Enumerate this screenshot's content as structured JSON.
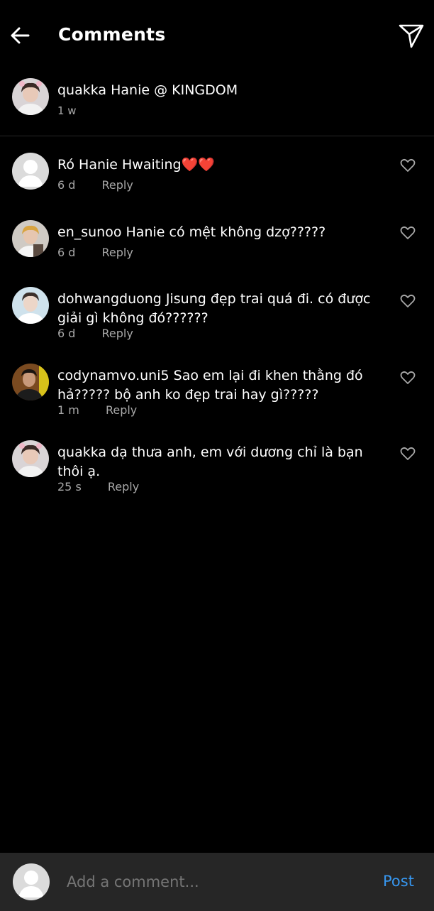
{
  "header": {
    "title": "Comments"
  },
  "caption": {
    "username": "quakka",
    "text": "Hanie @ KINGDOM",
    "time": "1 w"
  },
  "comments": [
    {
      "username": "Ró",
      "text": "Hanie Hwaiting",
      "emoji": "❤️❤️",
      "time": "6 d",
      "reply": "Reply",
      "avatar": "default-avatar"
    },
    {
      "username": "en_sunoo",
      "text": "Hanie có mệt không dzợ?????",
      "time": "6 d",
      "reply": "Reply",
      "avatar": "profile-photo"
    },
    {
      "username": "dohwangduong",
      "text": "Jisung đẹp trai quá đi. có được giải gì không đó??????",
      "time": "6 d",
      "reply": "Reply",
      "avatar": "profile-photo"
    },
    {
      "username": "codynamvo.uni5",
      "text": "Sao em lại đi khen thằng đó hả????? bộ anh ko đẹp trai hay gì?????",
      "time": "1 m",
      "reply": "Reply",
      "avatar": "profile-photo"
    },
    {
      "username": "quakka",
      "text": "dạ thưa anh, em với dương chỉ là bạn thôi ạ.",
      "time": "25 s",
      "reply": "Reply",
      "avatar": "profile-photo"
    }
  ],
  "composer": {
    "placeholder": "Add a comment...",
    "post_label": "Post"
  },
  "colors": {
    "background": "#000000",
    "muted_text": "#a8a8a8",
    "composer_bg": "#262626",
    "post_blue": "#3797f0"
  },
  "icons": {
    "back": "back-arrow-icon",
    "send": "paper-plane-icon",
    "like": "heart-outline-icon"
  }
}
